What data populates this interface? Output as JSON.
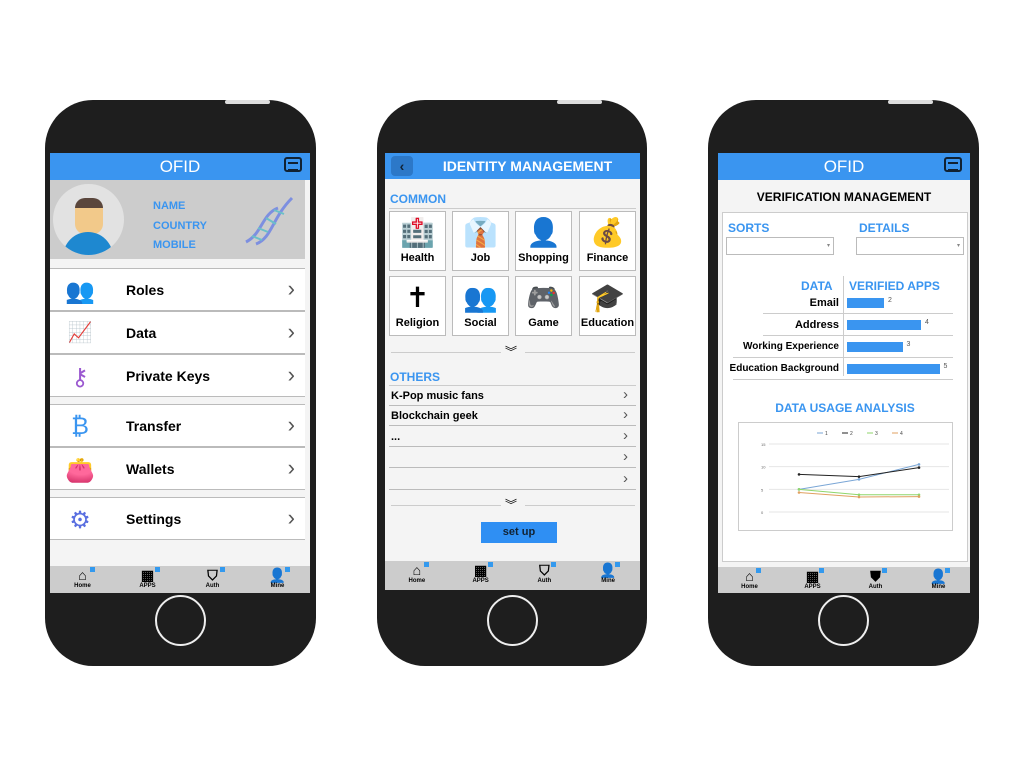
{
  "phone1": {
    "title": "OFID",
    "profile": {
      "name": "NAME",
      "country": "COUNTRY",
      "mobile": "MOBILE"
    },
    "menu": [
      {
        "label": "Roles",
        "icon": "users-icon"
      },
      {
        "label": "Data",
        "icon": "chart-icon"
      },
      {
        "label": "Private Keys",
        "icon": "key-icon"
      },
      {
        "label": "Transfer",
        "icon": "bitcoin-transfer-icon"
      },
      {
        "label": "Wallets",
        "icon": "wallet-icon"
      },
      {
        "label": "Settings",
        "icon": "gear-icon"
      }
    ]
  },
  "nav": {
    "home": "Home",
    "apps": "APPS",
    "auth": "Auth",
    "mine": "Mine"
  },
  "phone2": {
    "title": "IDENTITY MANAGEMENT",
    "common_label": "COMMON",
    "others_label": "OTHERS",
    "common": [
      "Health",
      "Job",
      "Shopping",
      "Finance",
      "Religion",
      "Social",
      "Game",
      "Education"
    ],
    "others": [
      "K-Pop music fans",
      "Blockchain geek",
      "...",
      "",
      ""
    ],
    "setup": "set up"
  },
  "phone3": {
    "title": "OFID",
    "section": "VERIFICATION MANAGEMENT",
    "sorts": "SORTS",
    "details": "DETAILS",
    "table": {
      "col1": "DATA",
      "col2": "VERIFIED APPS",
      "rows": [
        {
          "label": "Email",
          "value": 2
        },
        {
          "label": "Address",
          "value": 4
        },
        {
          "label": "Working Experience",
          "value": 3
        },
        {
          "label": "Education Background",
          "value": 5
        }
      ]
    },
    "analysis_title": "DATA USAGE ANALYSIS"
  },
  "colors": {
    "accent": "#3a95f0"
  },
  "chart_data": {
    "type": "line",
    "title": "",
    "x": [
      1,
      2,
      3
    ],
    "ylim": [
      0,
      15
    ],
    "yticks": [
      "0",
      "5",
      "10",
      "15"
    ],
    "legend": "top",
    "grid": true,
    "series": [
      {
        "name": "1",
        "color": "#7aa6d6",
        "values": [
          5,
          7.2,
          10.5
        ]
      },
      {
        "name": "2",
        "color": "#222222",
        "values": [
          8.3,
          7.8,
          9.8
        ]
      },
      {
        "name": "3",
        "color": "#8fd66b",
        "values": [
          5,
          3.8,
          3.8
        ]
      },
      {
        "name": "4",
        "color": "#e0a060",
        "values": [
          4.3,
          3.3,
          3.4
        ]
      }
    ]
  }
}
